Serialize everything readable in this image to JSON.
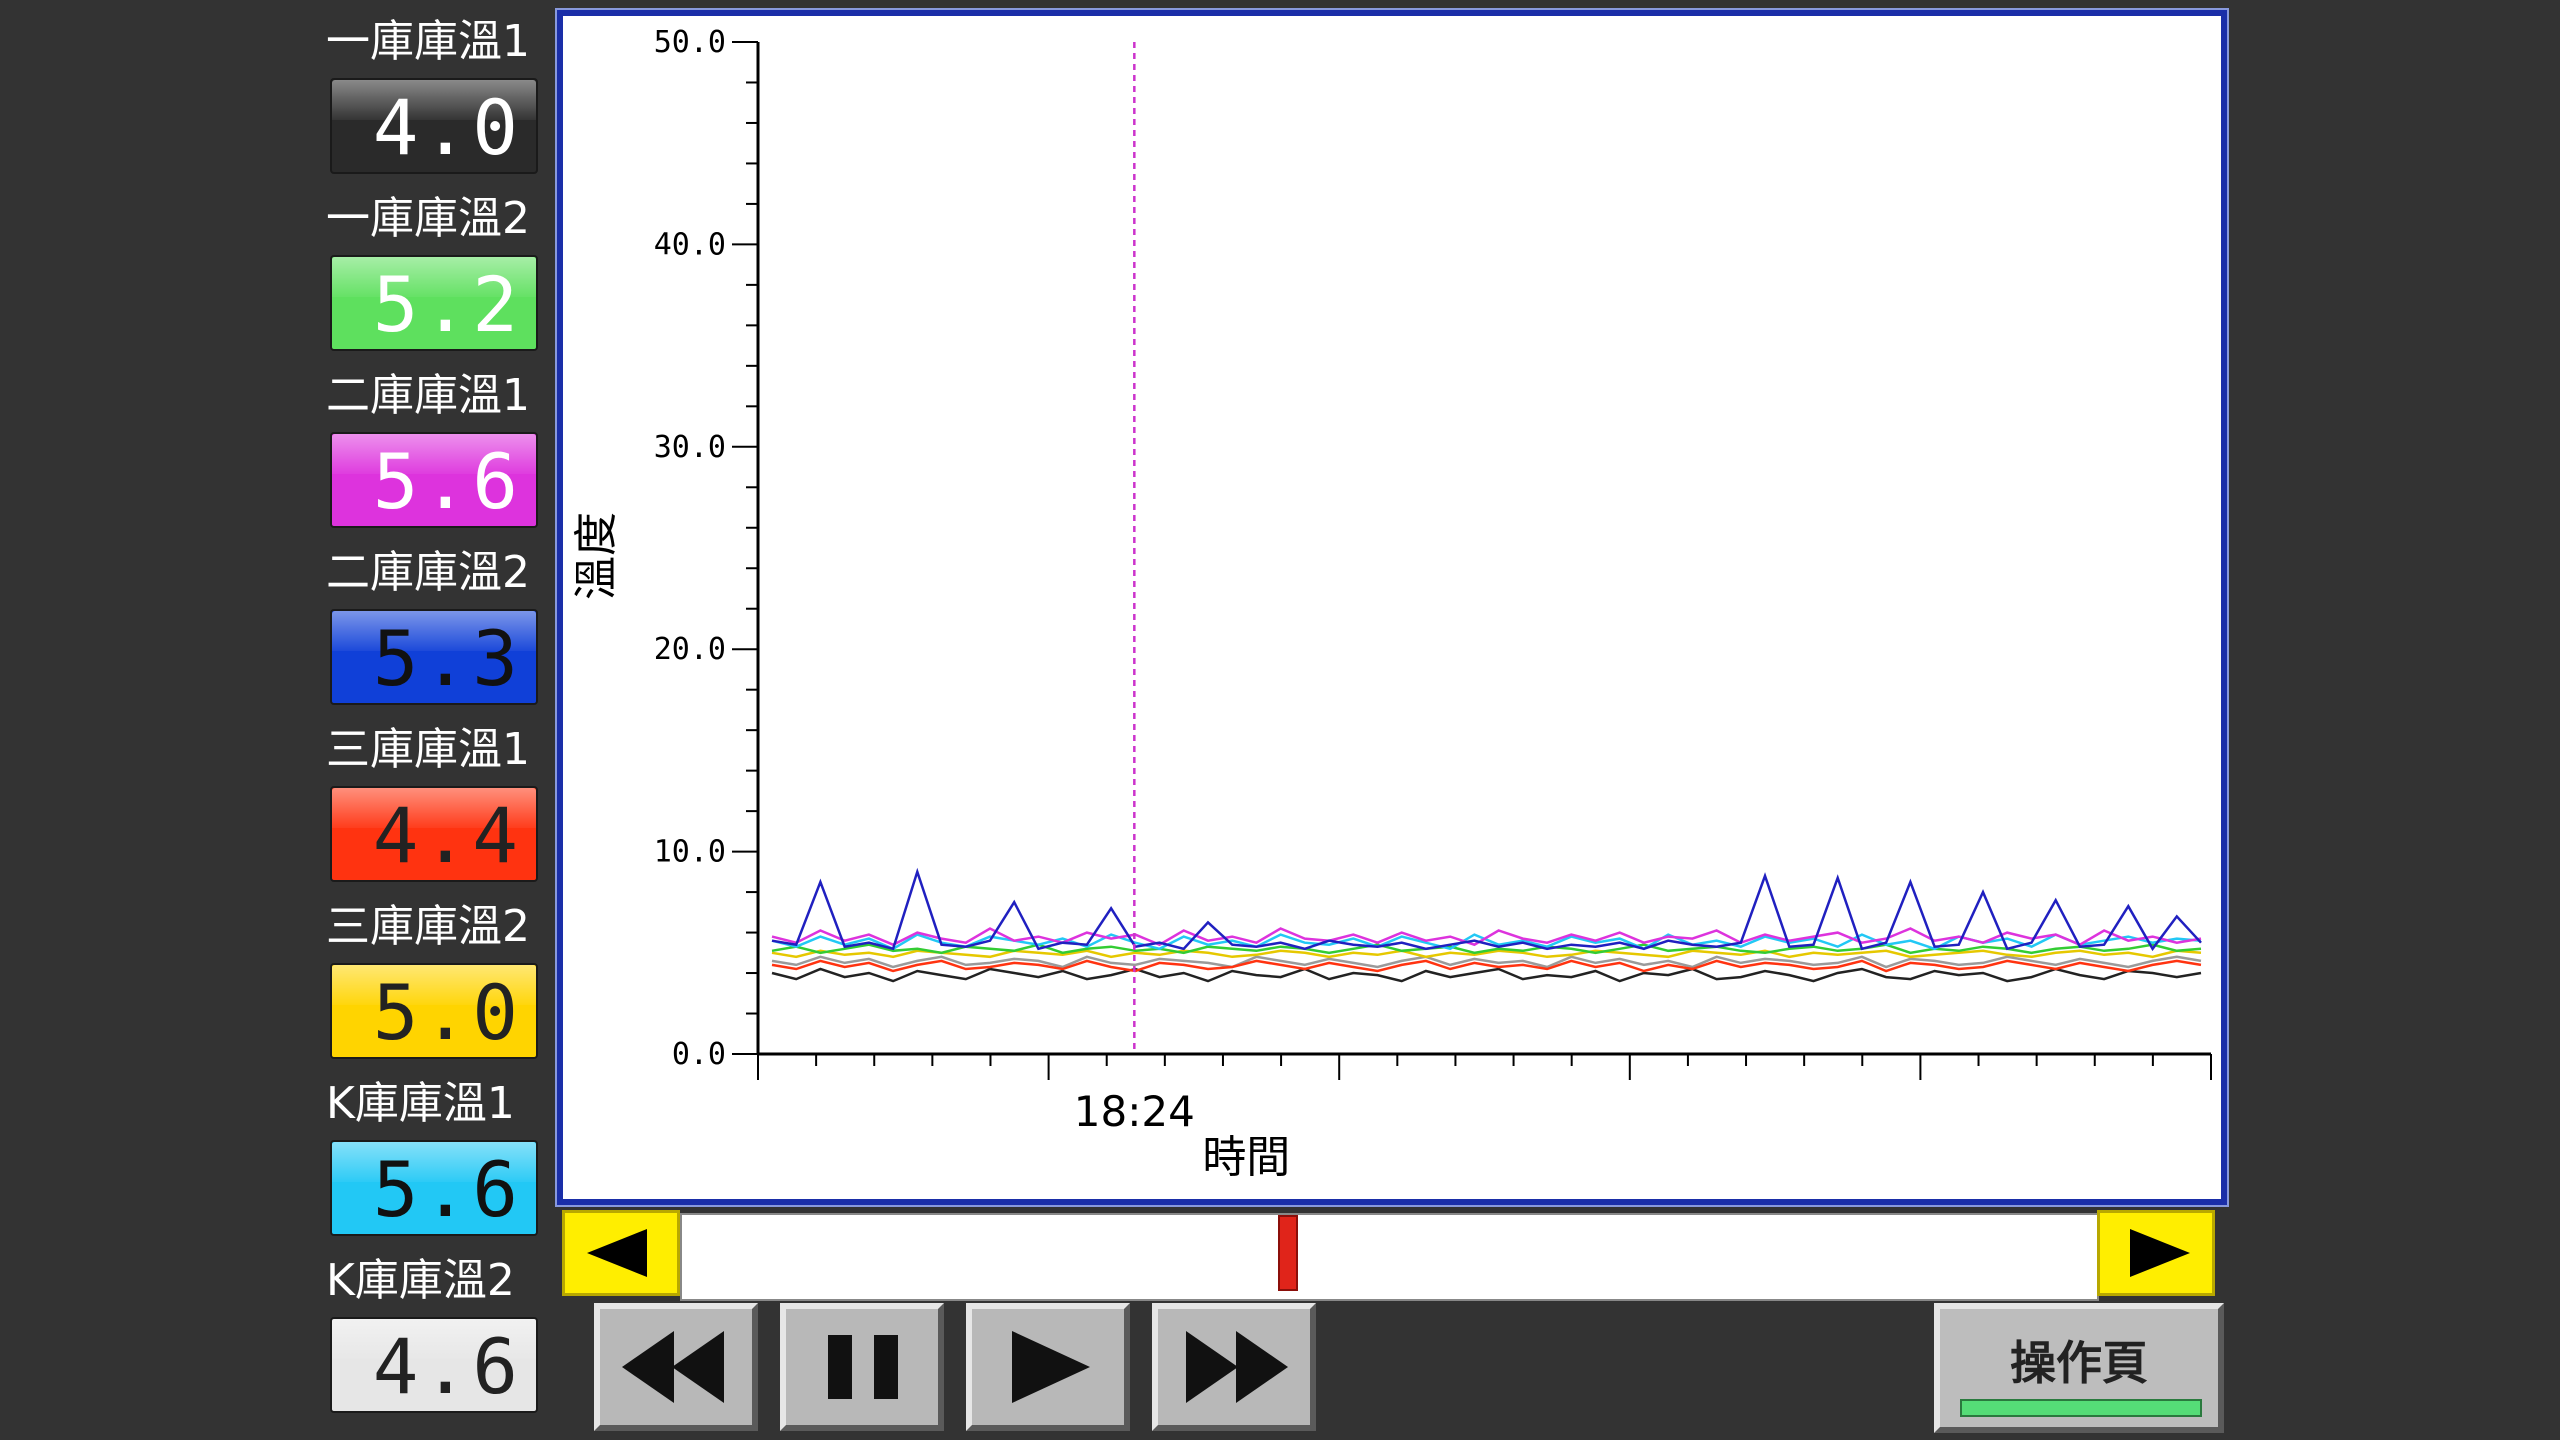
{
  "sensors": [
    {
      "label": "一庫庫溫1",
      "value": "4.0",
      "bg": "#2a2a2a",
      "text_color": "#ffffff"
    },
    {
      "label": "一庫庫溫2",
      "value": "5.2",
      "bg": "#5ee05e",
      "text_color": "#ffffff"
    },
    {
      "label": "二庫庫溫1",
      "value": "5.6",
      "bg": "#dd33dd",
      "text_color": "#ffffff"
    },
    {
      "label": "二庫庫溫2",
      "value": "5.3",
      "bg": "#1040d8",
      "text_color": "#111111"
    },
    {
      "label": "三庫庫溫1",
      "value": "4.4",
      "bg": "#ff3310",
      "text_color": "#222222"
    },
    {
      "label": "三庫庫溫2",
      "value": "5.0",
      "bg": "#ffd400",
      "text_color": "#222222"
    },
    {
      "label": "K庫庫溫1",
      "value": "5.6",
      "bg": "#22c8f5",
      "text_color": "#111111"
    },
    {
      "label": "K庫庫溫2",
      "value": "4.6",
      "bg": "#e6e6e6",
      "text_color": "#222222"
    }
  ],
  "buttons": {
    "operation_page": "操作頁"
  },
  "chart_data": {
    "type": "line",
    "ylabel": "溫度",
    "xlabel": "時間",
    "ylim": [
      0,
      50
    ],
    "y_tick_labels": [
      "0.0",
      "10.0",
      "20.0",
      "30.0",
      "40.0",
      "50.0"
    ],
    "x_tick_labels": [
      "18:24"
    ],
    "cursor_time": "18:24",
    "grid": false,
    "series": [
      {
        "name": "一庫庫溫1",
        "color": "#222222",
        "values": [
          4.0,
          3.7,
          4.2,
          3.8,
          4.0,
          3.6,
          4.1,
          3.9,
          3.7,
          4.2,
          4.0,
          3.8,
          4.1,
          3.7,
          3.9,
          4.2,
          3.8,
          4.0,
          3.6,
          4.1,
          3.9,
          3.8,
          4.2,
          3.7,
          4.0,
          3.9,
          3.6,
          4.1,
          3.8,
          4.0,
          4.2,
          3.7,
          3.9,
          3.8,
          4.1,
          3.6,
          4.0,
          3.9,
          4.2,
          3.7,
          3.8,
          4.1,
          3.9,
          3.6,
          4.0,
          4.2,
          3.8,
          3.7,
          4.1,
          3.9,
          4.0,
          3.6,
          3.8,
          4.2,
          3.9,
          3.7,
          4.1,
          4.0,
          3.8,
          4.0
        ]
      },
      {
        "name": "一庫庫溫2",
        "color": "#33cc33",
        "values": [
          5.1,
          5.3,
          5.0,
          5.2,
          5.4,
          5.1,
          5.2,
          5.0,
          5.3,
          5.2,
          5.1,
          5.4,
          5.0,
          5.2,
          5.3,
          5.1,
          5.2,
          5.0,
          5.3,
          5.2,
          5.1,
          5.3,
          5.2,
          5.0,
          5.2,
          5.4,
          5.1,
          5.2,
          5.3,
          5.0,
          5.2,
          5.1,
          5.3,
          5.2,
          5.0,
          5.2,
          5.4,
          5.1,
          5.2,
          5.3,
          5.1,
          5.0,
          5.2,
          5.3,
          5.1,
          5.2,
          5.4,
          5.0,
          5.2,
          5.1,
          5.3,
          5.2,
          5.0,
          5.2,
          5.3,
          5.1,
          5.2,
          5.4,
          5.1,
          5.2
        ]
      },
      {
        "name": "二庫庫溫1",
        "color": "#dd33dd",
        "values": [
          5.8,
          5.5,
          6.1,
          5.6,
          5.9,
          5.4,
          6.0,
          5.7,
          5.5,
          6.2,
          5.6,
          5.8,
          5.5,
          6.0,
          5.7,
          5.9,
          5.4,
          6.1,
          5.6,
          5.8,
          5.5,
          6.2,
          5.7,
          5.6,
          5.9,
          5.5,
          6.0,
          5.6,
          5.8,
          5.4,
          6.1,
          5.7,
          5.5,
          5.9,
          5.6,
          6.0,
          5.5,
          5.8,
          5.7,
          6.1,
          5.5,
          5.9,
          5.6,
          5.8,
          6.0,
          5.5,
          5.7,
          6.2,
          5.6,
          5.8,
          5.5,
          6.0,
          5.7,
          5.9,
          5.4,
          6.1,
          5.6,
          5.8,
          5.5,
          5.7
        ]
      },
      {
        "name": "二庫庫溫2",
        "color": "#2020c0",
        "values": [
          5.6,
          5.4,
          8.5,
          5.3,
          5.5,
          5.2,
          9.0,
          5.4,
          5.3,
          5.6,
          7.5,
          5.2,
          5.5,
          5.4,
          7.2,
          5.3,
          5.5,
          5.2,
          6.5,
          5.4,
          5.3,
          5.5,
          5.2,
          5.6,
          5.4,
          5.3,
          5.5,
          5.2,
          5.4,
          5.6,
          5.3,
          5.5,
          5.2,
          5.4,
          5.3,
          5.5,
          5.2,
          5.6,
          5.4,
          5.3,
          5.5,
          8.8,
          5.3,
          5.4,
          8.7,
          5.2,
          5.5,
          8.5,
          5.3,
          5.4,
          8.0,
          5.2,
          5.5,
          7.6,
          5.3,
          5.4,
          7.3,
          5.2,
          6.8,
          5.5
        ]
      },
      {
        "name": "三庫庫溫1",
        "color": "#ff3310",
        "values": [
          4.4,
          4.2,
          4.6,
          4.3,
          4.5,
          4.1,
          4.4,
          4.6,
          4.2,
          4.3,
          4.5,
          4.4,
          4.2,
          4.6,
          4.3,
          4.1,
          4.5,
          4.4,
          4.2,
          4.3,
          4.6,
          4.4,
          4.2,
          4.5,
          4.3,
          4.1,
          4.4,
          4.6,
          4.2,
          4.5,
          4.3,
          4.4,
          4.2,
          4.6,
          4.3,
          4.5,
          4.1,
          4.4,
          4.2,
          4.6,
          4.3,
          4.5,
          4.4,
          4.2,
          4.3,
          4.6,
          4.1,
          4.5,
          4.4,
          4.2,
          4.3,
          4.6,
          4.4,
          4.2,
          4.5,
          4.3,
          4.1,
          4.4,
          4.6,
          4.4
        ]
      },
      {
        "name": "三庫庫溫2",
        "color": "#e6c800",
        "values": [
          5.0,
          4.8,
          5.1,
          4.9,
          5.0,
          4.8,
          5.1,
          5.0,
          4.9,
          4.8,
          5.1,
          5.0,
          4.9,
          5.1,
          4.8,
          5.0,
          4.9,
          5.1,
          5.0,
          4.8,
          4.9,
          5.1,
          5.0,
          4.8,
          5.0,
          4.9,
          5.1,
          4.8,
          5.0,
          4.9,
          5.1,
          5.0,
          4.8,
          4.9,
          5.1,
          5.0,
          4.9,
          4.8,
          5.1,
          5.0,
          4.9,
          5.1,
          4.8,
          5.0,
          4.9,
          5.0,
          5.1,
          4.8,
          4.9,
          5.0,
          5.1,
          4.9,
          4.8,
          5.0,
          5.1,
          4.9,
          5.0,
          4.8,
          5.1,
          5.0
        ]
      },
      {
        "name": "K庫庫溫1",
        "color": "#22c8f5",
        "values": [
          5.6,
          5.3,
          5.8,
          5.4,
          5.7,
          5.2,
          5.9,
          5.5,
          5.3,
          5.8,
          5.6,
          5.4,
          5.7,
          5.3,
          5.9,
          5.5,
          5.2,
          5.8,
          5.4,
          5.6,
          5.3,
          5.9,
          5.5,
          5.4,
          5.7,
          5.3,
          5.8,
          5.5,
          5.2,
          5.9,
          5.4,
          5.6,
          5.3,
          5.8,
          5.5,
          5.7,
          5.2,
          5.9,
          5.4,
          5.6,
          5.3,
          5.8,
          5.5,
          5.7,
          5.3,
          5.9,
          5.4,
          5.6,
          5.2,
          5.8,
          5.5,
          5.7,
          5.3,
          5.9,
          5.4,
          5.6,
          5.8,
          5.5,
          5.7,
          5.6
        ]
      },
      {
        "name": "K庫庫溫2",
        "color": "#9a9a9a",
        "values": [
          4.6,
          4.4,
          4.8,
          4.5,
          4.7,
          4.3,
          4.6,
          4.8,
          4.4,
          4.5,
          4.7,
          4.6,
          4.3,
          4.8,
          4.5,
          4.4,
          4.7,
          4.6,
          4.5,
          4.3,
          4.8,
          4.6,
          4.4,
          4.7,
          4.5,
          4.3,
          4.6,
          4.8,
          4.4,
          4.7,
          4.5,
          4.6,
          4.3,
          4.8,
          4.5,
          4.7,
          4.4,
          4.6,
          4.3,
          4.8,
          4.5,
          4.7,
          4.6,
          4.4,
          4.5,
          4.8,
          4.3,
          4.7,
          4.6,
          4.4,
          4.5,
          4.8,
          4.6,
          4.4,
          4.7,
          4.5,
          4.3,
          4.6,
          4.8,
          4.6
        ]
      }
    ]
  },
  "scroll": {
    "thumb_position": 0.43
  },
  "colors": {
    "background": "#333333",
    "chart_border": "#1a2ea8",
    "scroll_button": "#ffee00",
    "scroll_thumb": "#e0241a",
    "cursor_line": "#cc33cc",
    "op_indicator": "#55dd77"
  },
  "icons": {
    "scroll_left": "left-triangle",
    "scroll_right": "right-triangle",
    "rewind": "double-left-triangle",
    "pause": "two-bars",
    "play": "right-triangle",
    "fast_forward": "double-right-triangle"
  }
}
